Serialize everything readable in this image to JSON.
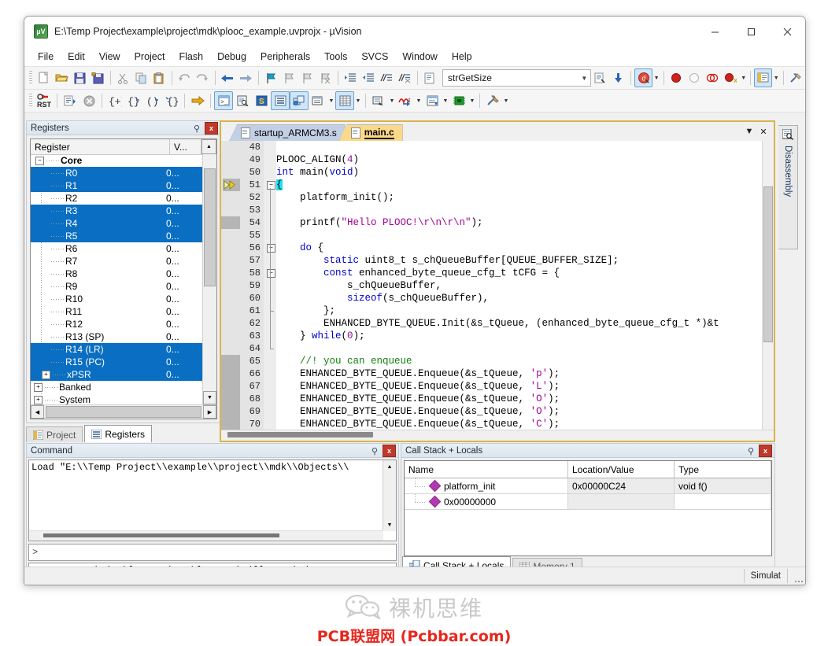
{
  "window": {
    "title": "E:\\Temp Project\\example\\project\\mdk\\plooc_example.uvprojx - µVision",
    "app_icon": "uvision-icon",
    "minimize": "minimize-icon",
    "maximize": "maximize-icon",
    "close": "close-icon"
  },
  "menu": {
    "items": [
      "File",
      "Edit",
      "View",
      "Project",
      "Flash",
      "Debug",
      "Peripherals",
      "Tools",
      "SVCS",
      "Window",
      "Help"
    ]
  },
  "toolbar": {
    "symbol_combo_value": "strGetSize",
    "row1_icons": [
      "new-file-icon",
      "open-file-icon",
      "save-icon",
      "save-all-icon",
      "cut-icon",
      "copy-icon",
      "paste-icon",
      "undo-icon",
      "redo-icon",
      "navigate-back-icon",
      "navigate-forward-icon",
      "bookmark-toggle-icon",
      "bookmark-prev-icon",
      "bookmark-next-icon",
      "bookmark-clear-icon",
      "indent-icon",
      "outdent-icon",
      "comment-icon",
      "uncomment-icon"
    ],
    "row2_icons": [
      "reset-icon",
      "load-icon",
      "stop-icon",
      "step-into-icon",
      "step-over-icon",
      "step-out-icon",
      "run-to-cursor-icon",
      "show-next-statement-icon",
      "command-window-icon",
      "disassembly-window-icon",
      "symbols-window-icon",
      "registers-window-icon",
      "call-stack-window-icon",
      "watch-window-icon",
      "memory-window-icon",
      "serial-window-icon",
      "analysis-window-icon",
      "trace-icon",
      "system-viewer-icon",
      "toolbox-icon"
    ]
  },
  "registers": {
    "panel_title": "Registers",
    "pin_icon": "pin-icon",
    "close_icon": "close-icon",
    "columns": [
      "Register",
      "V..."
    ],
    "root": "Core",
    "rows": [
      {
        "label": "R0",
        "value": "0...",
        "selected": true
      },
      {
        "label": "R1",
        "value": "0...",
        "selected": true
      },
      {
        "label": "R2",
        "value": "0...",
        "selected": false
      },
      {
        "label": "R3",
        "value": "0...",
        "selected": true
      },
      {
        "label": "R4",
        "value": "0...",
        "selected": true
      },
      {
        "label": "R5",
        "value": "0...",
        "selected": true
      },
      {
        "label": "R6",
        "value": "0...",
        "selected": false
      },
      {
        "label": "R7",
        "value": "0...",
        "selected": false
      },
      {
        "label": "R8",
        "value": "0...",
        "selected": false
      },
      {
        "label": "R9",
        "value": "0...",
        "selected": false
      },
      {
        "label": "R10",
        "value": "0...",
        "selected": false
      },
      {
        "label": "R11",
        "value": "0...",
        "selected": false
      },
      {
        "label": "R12",
        "value": "0...",
        "selected": false
      },
      {
        "label": "R13 (SP)",
        "value": "0...",
        "selected": false
      },
      {
        "label": "R14 (LR)",
        "value": "0...",
        "selected": true
      },
      {
        "label": "R15 (PC)",
        "value": "0...",
        "selected": true
      },
      {
        "label": "xPSR",
        "value": "0...",
        "selected": true,
        "expandable": true
      }
    ],
    "groups": [
      "Banked",
      "System"
    ],
    "dock_tabs": [
      {
        "label": "Project",
        "icon": "project-icon",
        "active": false
      },
      {
        "label": "Registers",
        "icon": "registers-icon",
        "active": true
      }
    ]
  },
  "editor": {
    "tabs": [
      {
        "label": "startup_ARMCM3.s",
        "active": false,
        "icon": "source-file-icon"
      },
      {
        "label": "main.c",
        "active": true,
        "icon": "source-file-icon"
      }
    ],
    "tab_list_icon": "chevron-down-icon",
    "tab_close_icon": "close-icon",
    "first_line_number": 48,
    "lines": [
      {
        "n": 48,
        "segs": [],
        "fold": "",
        "marker": ""
      },
      {
        "n": 49,
        "segs": [
          {
            "t": "PLOOC_ALIGN(",
            "c": ""
          },
          {
            "t": "4",
            "c": "num"
          },
          {
            "t": ")",
            "c": ""
          }
        ],
        "fold": "",
        "marker": ""
      },
      {
        "n": 50,
        "segs": [
          {
            "t": "int ",
            "c": "kw"
          },
          {
            "t": "main(",
            "c": ""
          },
          {
            "t": "void",
            "c": "kw"
          },
          {
            "t": ")",
            "c": ""
          }
        ],
        "fold": "",
        "marker": ""
      },
      {
        "n": 51,
        "segs": [
          {
            "t": "{",
            "c": "cursor-hl"
          }
        ],
        "fold": "minus",
        "marker": "pc-arrow"
      },
      {
        "n": 52,
        "segs": [
          {
            "t": "    platform_init();",
            "c": ""
          }
        ],
        "fold": "",
        "marker": ""
      },
      {
        "n": 53,
        "segs": [],
        "fold": "",
        "marker": ""
      },
      {
        "n": 54,
        "segs": [
          {
            "t": "    printf(",
            "c": ""
          },
          {
            "t": "\"Hello PLOOC!\\r\\n\\r\\n\"",
            "c": "str"
          },
          {
            "t": ");",
            "c": ""
          }
        ],
        "fold": "",
        "marker": "gray"
      },
      {
        "n": 55,
        "segs": [],
        "fold": "",
        "marker": ""
      },
      {
        "n": 56,
        "segs": [
          {
            "t": "    ",
            "c": ""
          },
          {
            "t": "do",
            "c": "kw"
          },
          {
            "t": " {",
            "c": ""
          }
        ],
        "fold": "minus",
        "marker": ""
      },
      {
        "n": 57,
        "segs": [
          {
            "t": "        ",
            "c": ""
          },
          {
            "t": "static",
            "c": "kw"
          },
          {
            "t": " uint8_t s_chQueueBuffer[QUEUE_BUFFER_SIZE];",
            "c": ""
          }
        ],
        "fold": "",
        "marker": ""
      },
      {
        "n": 58,
        "segs": [
          {
            "t": "        ",
            "c": ""
          },
          {
            "t": "const",
            "c": "kw"
          },
          {
            "t": " enhanced_byte_queue_cfg_t tCFG = {",
            "c": ""
          }
        ],
        "fold": "minus",
        "marker": ""
      },
      {
        "n": 59,
        "segs": [
          {
            "t": "            s_chQueueBuffer,",
            "c": ""
          }
        ],
        "fold": "",
        "marker": ""
      },
      {
        "n": 60,
        "segs": [
          {
            "t": "            ",
            "c": ""
          },
          {
            "t": "sizeof",
            "c": "kw"
          },
          {
            "t": "(s_chQueueBuffer),",
            "c": ""
          }
        ],
        "fold": "",
        "marker": ""
      },
      {
        "n": 61,
        "segs": [
          {
            "t": "        };",
            "c": ""
          }
        ],
        "fold": "tick",
        "marker": ""
      },
      {
        "n": 62,
        "segs": [
          {
            "t": "        ENHANCED_BYTE_QUEUE.Init(&s_tQueue, (enhanced_byte_queue_cfg_t *)&t",
            "c": ""
          }
        ],
        "fold": "",
        "marker": ""
      },
      {
        "n": 63,
        "segs": [
          {
            "t": "    } ",
            "c": ""
          },
          {
            "t": "while",
            "c": "kw"
          },
          {
            "t": "(",
            "c": ""
          },
          {
            "t": "0",
            "c": "num"
          },
          {
            "t": ");",
            "c": ""
          }
        ],
        "fold": "",
        "marker": ""
      },
      {
        "n": 64,
        "segs": [],
        "fold": "tick",
        "marker": ""
      },
      {
        "n": 65,
        "segs": [
          {
            "t": "    //! you can enqueue",
            "c": "cmt"
          }
        ],
        "fold": "",
        "marker": "gray"
      },
      {
        "n": 66,
        "segs": [
          {
            "t": "    ENHANCED_BYTE_QUEUE.Enqueue(&s_tQueue, ",
            "c": ""
          },
          {
            "t": "'p'",
            "c": "str"
          },
          {
            "t": ");",
            "c": ""
          }
        ],
        "fold": "",
        "marker": "gray"
      },
      {
        "n": 67,
        "segs": [
          {
            "t": "    ENHANCED_BYTE_QUEUE.Enqueue(&s_tQueue, ",
            "c": ""
          },
          {
            "t": "'L'",
            "c": "str"
          },
          {
            "t": ");",
            "c": ""
          }
        ],
        "fold": "",
        "marker": "gray"
      },
      {
        "n": 68,
        "segs": [
          {
            "t": "    ENHANCED_BYTE_QUEUE.Enqueue(&s_tQueue, ",
            "c": ""
          },
          {
            "t": "'O'",
            "c": "str"
          },
          {
            "t": ");",
            "c": ""
          }
        ],
        "fold": "",
        "marker": "gray"
      },
      {
        "n": 69,
        "segs": [
          {
            "t": "    ENHANCED_BYTE_QUEUE.Enqueue(&s_tQueue, ",
            "c": ""
          },
          {
            "t": "'O'",
            "c": "str"
          },
          {
            "t": ");",
            "c": ""
          }
        ],
        "fold": "",
        "marker": "gray"
      },
      {
        "n": 70,
        "segs": [
          {
            "t": "    ENHANCED_BYTE_QUEUE.Enqueue(&s_tQueue, ",
            "c": ""
          },
          {
            "t": "'C'",
            "c": "str"
          },
          {
            "t": ");",
            "c": ""
          }
        ],
        "fold": "",
        "marker": "gray"
      }
    ]
  },
  "right_strip": {
    "disassembly_tab": "Disassembly",
    "disassembly_icon": "disassembly-icon"
  },
  "command": {
    "panel_title": "Command",
    "pin_icon": "pin-icon",
    "close_icon": "close-icon",
    "output": "Load \"E:\\\\Temp Project\\\\example\\\\project\\\\mdk\\\\Objects\\\\",
    "prompt": ">",
    "input_value": "",
    "hints": "ASSIGN BreakDisable BreakEnable BreakKill BreakList"
  },
  "callstack": {
    "panel_title": "Call Stack + Locals",
    "pin_icon": "pin-icon",
    "close_icon": "close-icon",
    "columns": [
      "Name",
      "Location/Value",
      "Type"
    ],
    "rows": [
      {
        "name": "platform_init",
        "location": "0x00000C24",
        "type": "void f()"
      },
      {
        "name": "0x00000000",
        "location": "",
        "type": ""
      }
    ],
    "tabs": [
      {
        "label": "Call Stack + Locals",
        "icon": "call-stack-icon",
        "active": true
      },
      {
        "label": "Memory 1",
        "icon": "memory-icon",
        "active": false
      }
    ]
  },
  "statusbar": {
    "left": "",
    "simulator": "Simulat",
    "grip_icon": "resize-grip-icon"
  },
  "watermark": {
    "wechat_icon": "wechat-icon",
    "cn_text": "裸机思维",
    "red_text": "PCB联盟网 (Pcbbar.com)"
  },
  "colors": {
    "selection_blue": "#0a6fc2",
    "active_tab_yellow": "#fbd98a",
    "inactive_tab_blue": "#c2cfe4",
    "editor_border": "#d8b44a",
    "keyword": "#0000d0",
    "string": "#a0009a",
    "comment": "#108010",
    "watermark_red": "#e8261c"
  }
}
